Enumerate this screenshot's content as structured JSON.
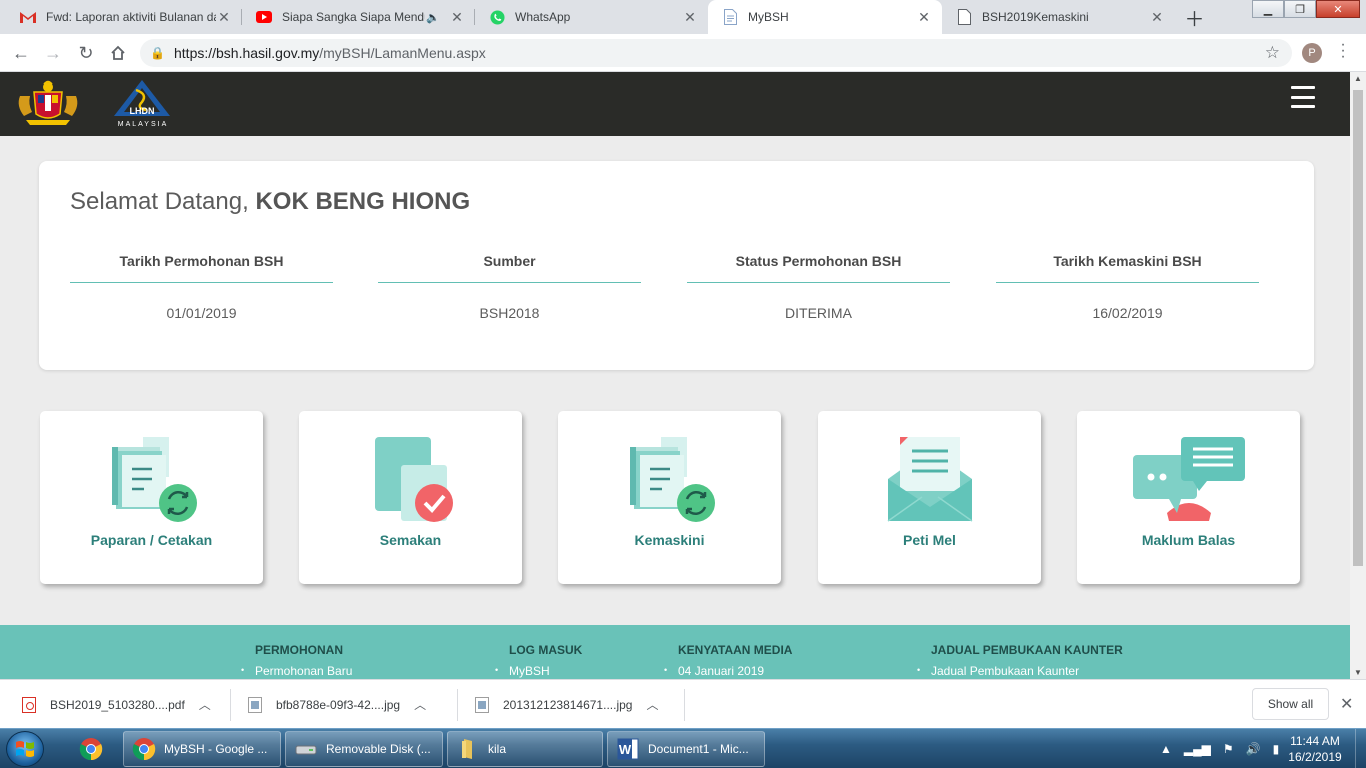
{
  "browser": {
    "tabs": [
      {
        "title": "Fwd: Laporan aktiviti Bulanan da",
        "icon": "gmail-icon",
        "active": false
      },
      {
        "title": "Siapa Sangka Siapa Menduga",
        "icon": "youtube-icon",
        "active": false,
        "audio": true
      },
      {
        "title": "WhatsApp",
        "icon": "whatsapp-icon",
        "active": false
      },
      {
        "title": "MyBSH",
        "icon": "document-icon",
        "active": true
      },
      {
        "title": "BSH2019Kemaskini",
        "icon": "document-icon",
        "active": false
      }
    ],
    "url_host": "https://bsh.hasil.gov.my",
    "url_path": "/myBSH/LamanMenu.aspx",
    "profile_initial": "P"
  },
  "header": {
    "logo_text": "LHDN",
    "logo_subtext": "MALAYSIA"
  },
  "welcome": {
    "greeting": "Selamat Datang,",
    "name": "KOK BENG HIONG",
    "columns": [
      {
        "label": "Tarikh Permohonan BSH",
        "value": "01/01/2019"
      },
      {
        "label": "Sumber",
        "value": "BSH2018"
      },
      {
        "label": "Status Permohonan BSH",
        "value": "DITERIMA"
      },
      {
        "label": "Tarikh Kemaskini BSH",
        "value": "16/02/2019"
      }
    ]
  },
  "menu": [
    {
      "label": "Paparan / Cetakan",
      "icon": "documents-sync-icon"
    },
    {
      "label": "Semakan",
      "icon": "documents-check-icon"
    },
    {
      "label": "Kemaskini",
      "icon": "documents-sync-icon"
    },
    {
      "label": "Peti Mel",
      "icon": "mail-icon"
    },
    {
      "label": "Maklum Balas",
      "icon": "chat-feedback-icon"
    }
  ],
  "footer": {
    "columns": [
      {
        "heading": "PERMOHONAN",
        "items": [
          "Permohonan Baru"
        ]
      },
      {
        "heading": "LOG MASUK",
        "items": [
          "MyBSH"
        ]
      },
      {
        "heading": "KENYATAAN MEDIA",
        "items": [
          "04 Januari 2019"
        ]
      },
      {
        "heading": "JADUAL PEMBUKAAN KAUNTER",
        "items": [
          "Jadual Pembukaan Kaunter"
        ]
      }
    ]
  },
  "downloads": {
    "items": [
      {
        "name": "BSH2019_5103280....pdf",
        "type": "pdf"
      },
      {
        "name": "bfb8788e-09f3-42....jpg",
        "type": "image"
      },
      {
        "name": "201312123814671....jpg",
        "type": "image"
      }
    ],
    "show_all": "Show all"
  },
  "taskbar": {
    "items": [
      {
        "label": "MyBSH - Google ...",
        "icon": "chrome-icon"
      },
      {
        "label": "Removable Disk (...",
        "icon": "drive-icon"
      },
      {
        "label": "kila",
        "icon": "folder-icon"
      },
      {
        "label": "Document1 - Mic...",
        "icon": "word-icon"
      }
    ],
    "time": "11:44 AM",
    "date": "16/2/2019"
  },
  "colors": {
    "accent_teal": "#69c2b8",
    "label_teal": "#2c7f7a",
    "header_dark": "#2a2b28",
    "page_bg": "#ececec"
  }
}
